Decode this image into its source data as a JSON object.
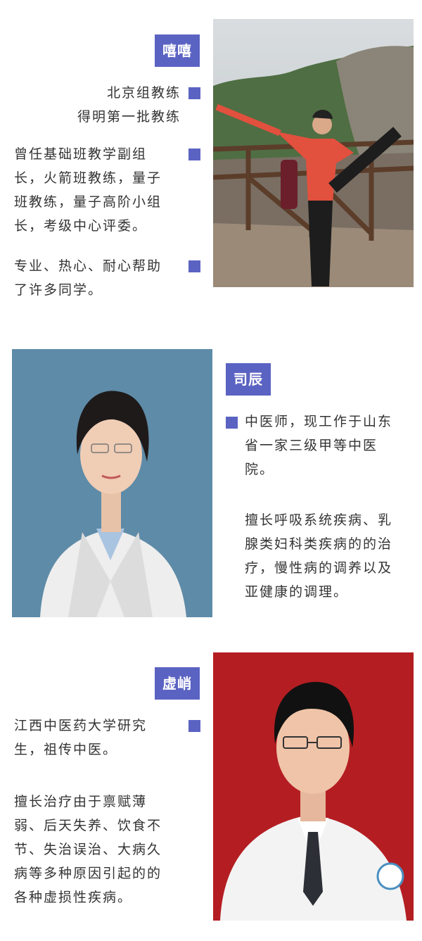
{
  "profiles": [
    {
      "name": "嘻嘻",
      "paragraphs": [
        {
          "lines": [
            "北京组教练",
            "得明第一批教练"
          ]
        },
        {
          "lines": [
            "曾任基础班教学副组",
            "长，火箭班教练，量子",
            "班教练，量子高阶小组",
            "长，考级中心评委。"
          ]
        },
        {
          "lines": [
            "专业、热心、耐心帮助",
            "了许多同学。"
          ]
        }
      ]
    },
    {
      "name": "司辰",
      "paragraphs": [
        {
          "lines": [
            "中医师，现工作于山东",
            "省一家三级甲等中医",
            "院。"
          ]
        },
        {
          "lines": [
            "擅长呼吸系统疾病、乳",
            "腺类妇科类疾病的的治",
            "疗，慢性病的调养以及",
            "亚健康的调理。"
          ]
        }
      ]
    },
    {
      "name": "虚峭",
      "paragraphs": [
        {
          "lines": [
            "江西中医药大学研究",
            "生，祖传中医。"
          ]
        },
        {
          "lines": [
            "擅长治疗由于禀赋薄",
            "弱、后天失养、饮食不",
            "节、失治误治、大病久",
            "病等多种原因引起的的",
            "各种虚损性疾病。"
          ]
        }
      ]
    }
  ],
  "colors": {
    "accent": "#5b63c2",
    "text": "#333333"
  }
}
